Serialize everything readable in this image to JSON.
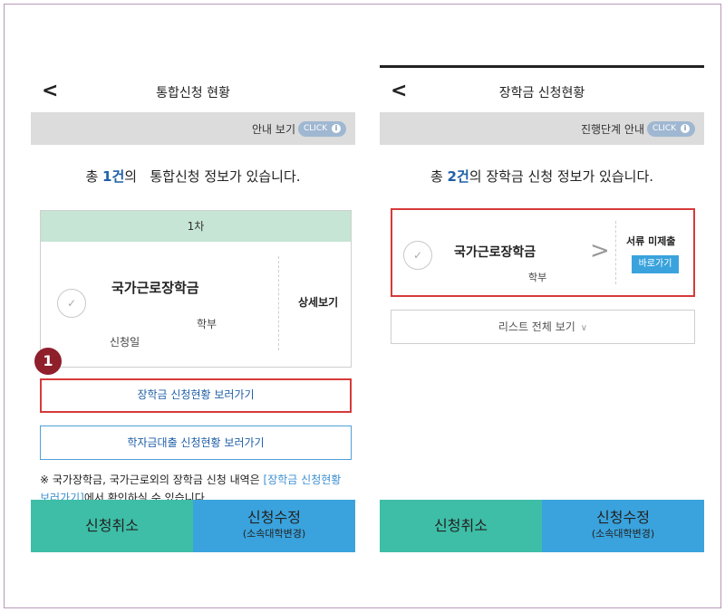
{
  "phone1": {
    "header": {
      "back_icon": "chevron-left-icon",
      "back_glyph": "<",
      "title": "통합신청 현황"
    },
    "guide": {
      "text": "안내 보기",
      "click_label": "CLICK",
      "info_glyph": "i"
    },
    "summary": {
      "prefix": "총 ",
      "count": "1건",
      "suffix": "의   통합신청 정보가 있습니다."
    },
    "card": {
      "round": "1차",
      "check_glyph": "✓",
      "scholarship": "국가근로장학금",
      "dept": "학부",
      "apply_date_label": "신청일",
      "detail_label": "상세보기"
    },
    "step_badge": "1",
    "buttons": {
      "view_scholarship": "장학금 신청현황 보러가기",
      "view_loan": "학자금대출 신청현황 보러가기"
    },
    "notice": {
      "text": "※ 국가장학금, 국가근로외의 장학금 신청 내역은 ",
      "link": "[장학금 신청현황 보러가기]",
      "rest": "에서 확인하실 수 있습니다."
    },
    "bottom": {
      "cancel": "신청취소",
      "modify": "신청수정",
      "modify_sub": "(소속대학변경)"
    }
  },
  "phone2": {
    "header": {
      "back_icon": "chevron-left-icon",
      "back_glyph": "<",
      "title": "장학금 신청현황"
    },
    "guide": {
      "text": "진행단계 안내",
      "click_label": "CLICK",
      "info_glyph": "i"
    },
    "summary": {
      "prefix": "총 ",
      "count": "2건",
      "suffix": "의 장학금 신청 정보가 있습니다."
    },
    "card": {
      "check_glyph": "✓",
      "scholarship": "국가근로장학금",
      "dept": "학부",
      "chevron_glyph": ">",
      "doc_status": "서류 미제출",
      "go_label": "바로가기"
    },
    "list_all": {
      "label": "리스트 전체 보기",
      "chevron_glyph": "∨"
    },
    "bottom": {
      "cancel": "신청취소",
      "modify": "신청수정",
      "modify_sub": "(소속대학변경)"
    }
  },
  "colors": {
    "round_header_bg": "#c6e5d4",
    "highlight_border": "#d63a3a",
    "link_blue": "#1f5fa8",
    "cancel_bg": "#3ebea7",
    "modify_bg": "#3aa3dd",
    "step_badge_bg": "#8e1f2b"
  }
}
